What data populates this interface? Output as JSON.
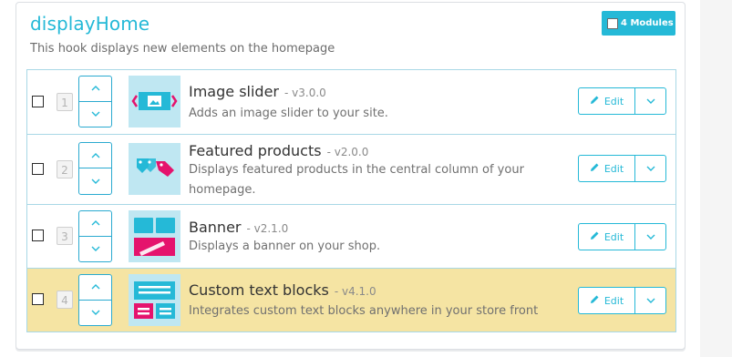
{
  "hook": {
    "title": "displayHome",
    "description": "This hook displays new elements on the homepage",
    "badge_label": "4 Modules"
  },
  "modules": [
    {
      "position": "1",
      "name": "Image slider",
      "version": "- v3.0.0",
      "description": "Adds an image slider to your site.",
      "icon": "image-slider-icon",
      "edit_label": "Edit",
      "highlighted": false
    },
    {
      "position": "2",
      "name": "Featured products",
      "version": "- v2.0.0",
      "description": "Displays featured products in the central column of your homepage.",
      "icon": "featured-products-icon",
      "edit_label": "Edit",
      "highlighted": false
    },
    {
      "position": "3",
      "name": "Banner",
      "version": "- v2.1.0",
      "description": "Displays a banner on your shop.",
      "icon": "banner-icon",
      "edit_label": "Edit",
      "highlighted": false
    },
    {
      "position": "4",
      "name": "Custom text blocks",
      "version": "- v4.1.0",
      "description": "Integrates custom text blocks anywhere in your store front",
      "icon": "custom-text-blocks-icon",
      "edit_label": "Edit",
      "highlighted": true
    }
  ],
  "colors": {
    "accent": "#25b9d7",
    "highlight_row": "#f5e4a3",
    "logo_bg": "#bfe7f2",
    "logo_primary": "#25b9d7",
    "logo_secondary": "#e5136d"
  }
}
